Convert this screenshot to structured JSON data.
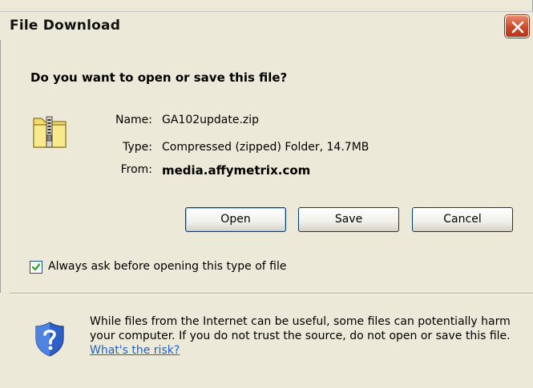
{
  "window": {
    "title": "File Download",
    "close_icon": "close-icon"
  },
  "question": "Do you want to open or save this file?",
  "file": {
    "icon": "zip-folder-icon",
    "name_label": "Name:",
    "name_value": "GA102update.zip",
    "type_label": "Type:",
    "type_value": "Compressed (zipped) Folder, 14.7MB",
    "from_label": "From:",
    "from_value": "media.affymetrix.com"
  },
  "buttons": {
    "open": "Open",
    "save": "Save",
    "cancel": "Cancel"
  },
  "checkbox": {
    "label": "Always ask before opening this type of file",
    "checked": true
  },
  "warning": {
    "icon": "shield-question-icon",
    "text": "While files from the Internet can be useful, some files can potentially harm your computer. If you do not trust the source, do not open or save this file.",
    "link": "What's the risk?"
  },
  "colors": {
    "background": "#ece9d8",
    "link": "#1f63c6",
    "close_button": "#c84a2a"
  }
}
